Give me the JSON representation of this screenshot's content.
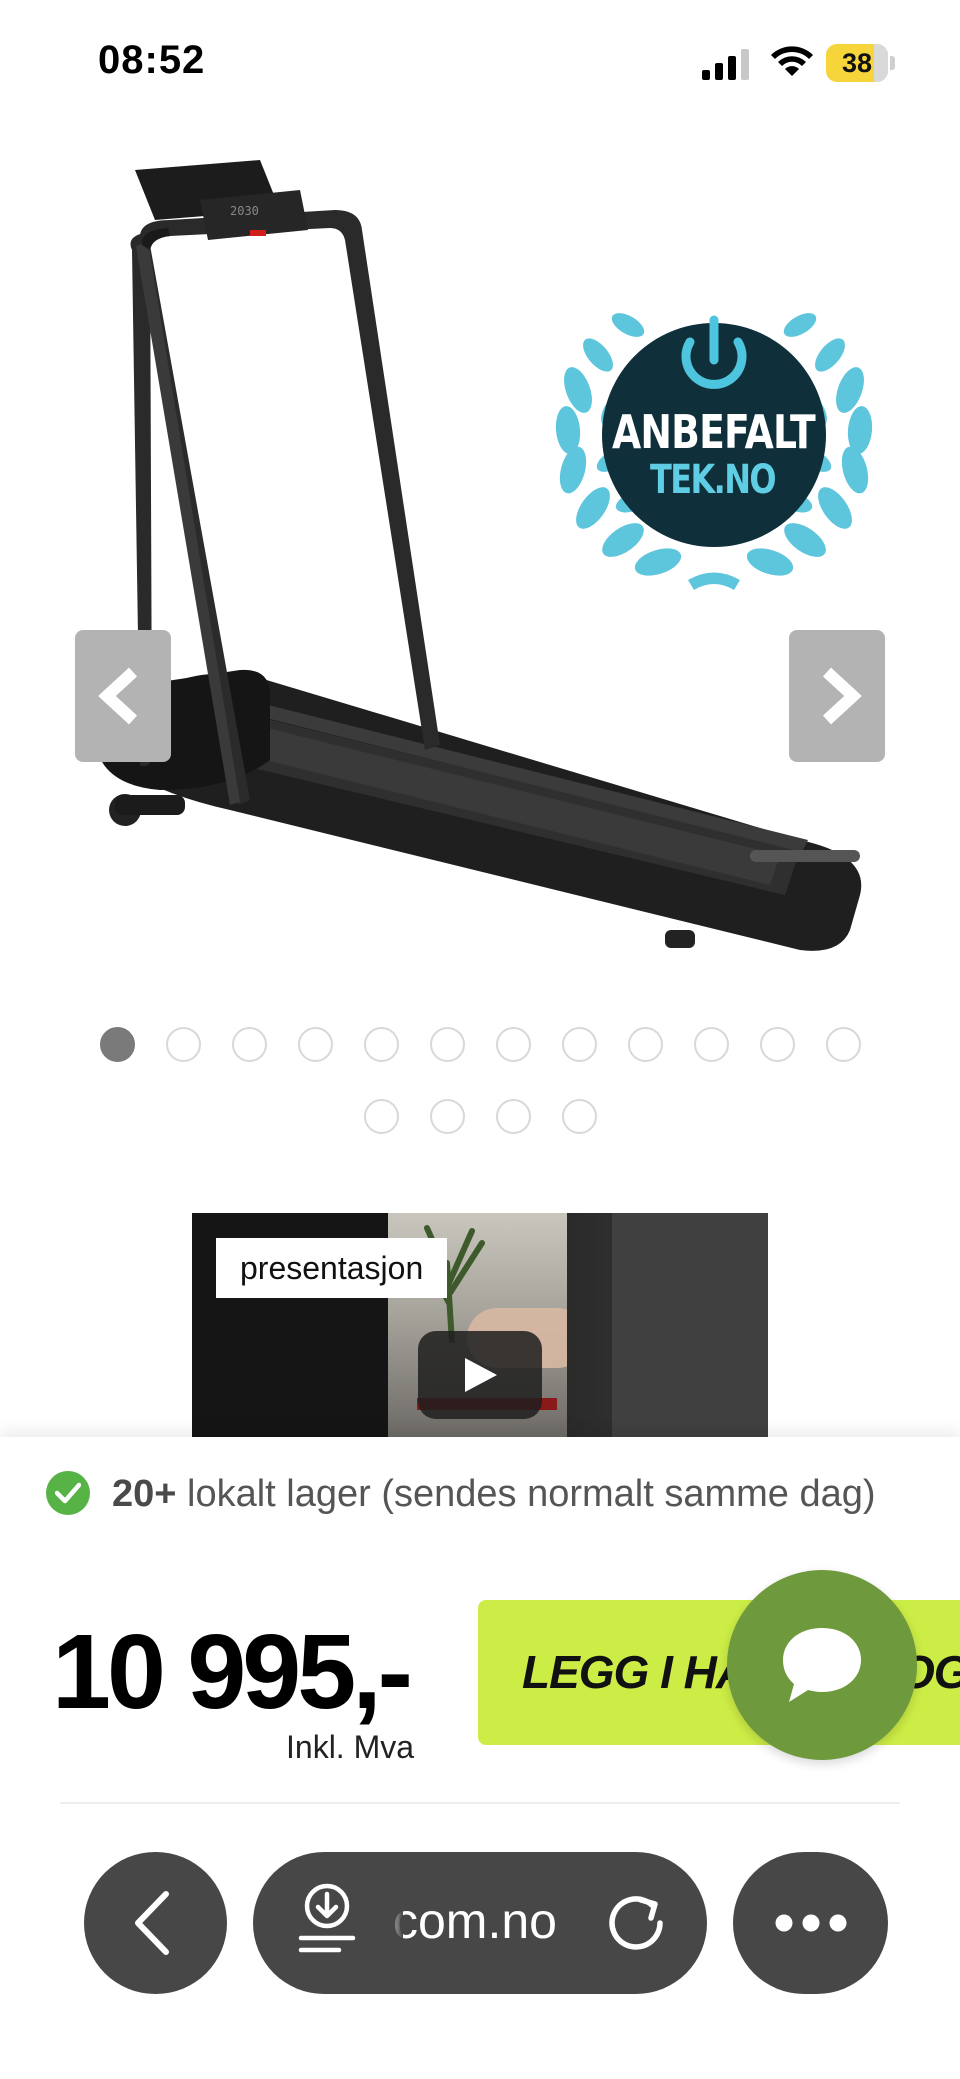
{
  "status_bar": {
    "time": "08:52",
    "battery_level": "38",
    "icons": [
      "signal-icon",
      "wifi-icon",
      "battery-icon"
    ]
  },
  "product_gallery": {
    "badge": {
      "line1": "ANBEFALT",
      "line2": "TEK.NO"
    },
    "prev_icon": "chevron-left-icon",
    "next_icon": "chevron-right-icon",
    "total_images": 16,
    "active_index": 0
  },
  "video": {
    "label": "presentasjon",
    "icon": "play-icon"
  },
  "purchase": {
    "stock_count": "20+",
    "stock_text": " lokalt lager (sendes normalt samme dag)",
    "price": "10 995,-",
    "price_note": "Inkl. Mva",
    "cart_button_label": "LEGG I HANDLEVOGN",
    "accent_color": "#ccec46",
    "chat_color": "#6e9a3d"
  },
  "browser_toolbar": {
    "url": "com.no",
    "icons": [
      "back-icon",
      "download-icon",
      "reload-icon",
      "more-icon"
    ]
  }
}
